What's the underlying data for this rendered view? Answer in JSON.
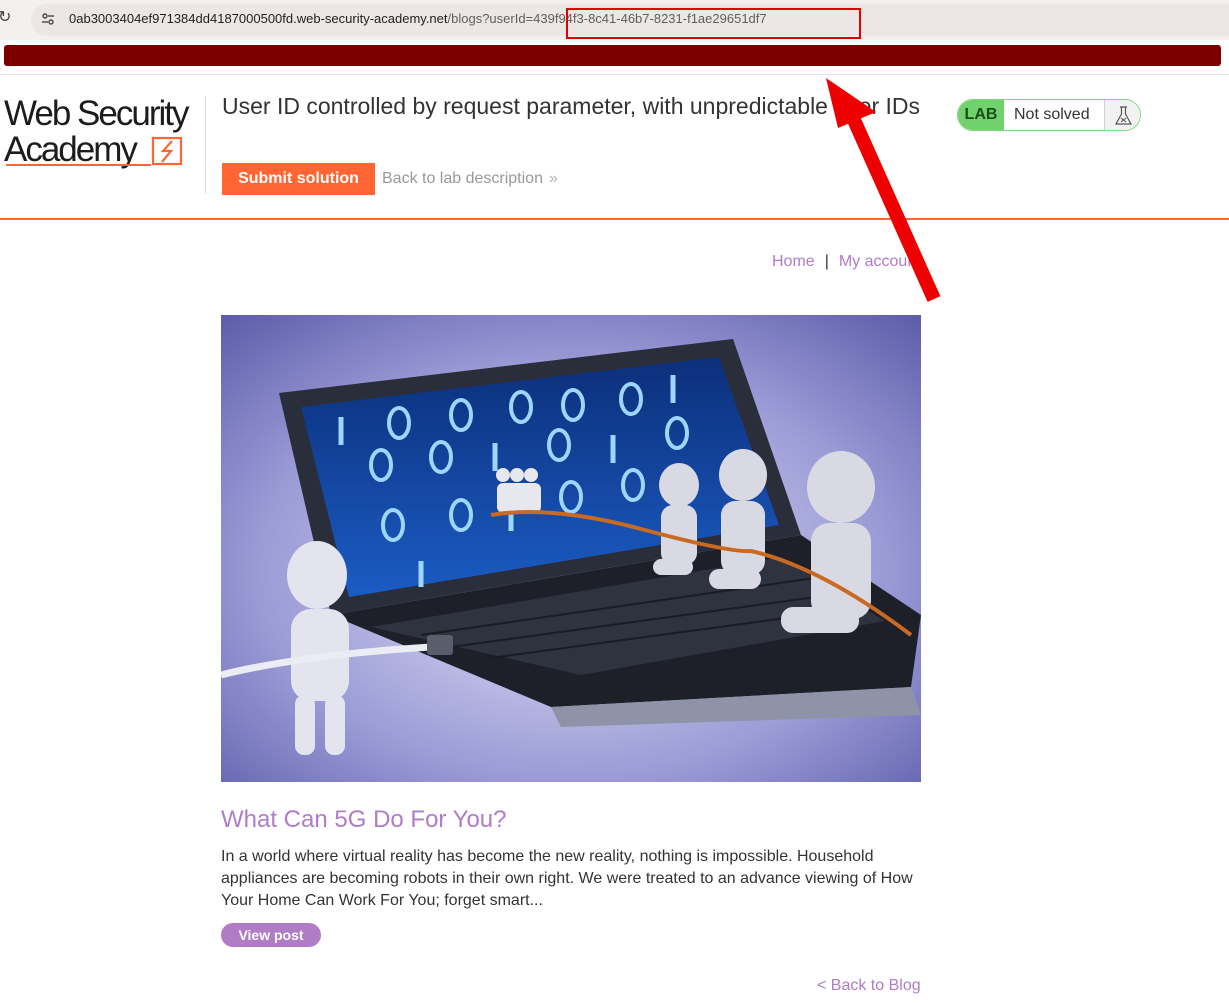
{
  "browser": {
    "url_host": "0ab3003404ef971384dd4187000500fd.web-security-academy.net",
    "url_path": "/blogs?userId=439f94f3-8c41-46b7-8231-f1ae29651df7"
  },
  "header": {
    "logo_line1": "Web Security",
    "logo_line2": "Academy",
    "lab_title": "User ID controlled by request parameter, with unpredictable user IDs",
    "submit_label": "Submit solution",
    "back_description_label": "Back to lab description",
    "lab_badge": "LAB",
    "lab_status": "Not solved"
  },
  "nav": {
    "home": "Home",
    "separator": "|",
    "my_account": "My account"
  },
  "post": {
    "title": "What Can 5G Do For You?",
    "summary": "In a world where virtual reality has become the new reality, nothing is impossible. Household appliances are becoming robots in their own right. We were treated to an advance viewing of How Your Home Can Work For You; forget smart...",
    "view_label": "View post",
    "image_icon": "laptop-tug-of-war-illustration"
  },
  "footer": {
    "back_to_blog": "< Back to Blog"
  },
  "colors": {
    "accent_orange": "#ff6633",
    "link_purple": "#b07cc6",
    "lab_green": "#70d16d",
    "annotation_red": "#e00000",
    "redaction": "#7d0000"
  }
}
